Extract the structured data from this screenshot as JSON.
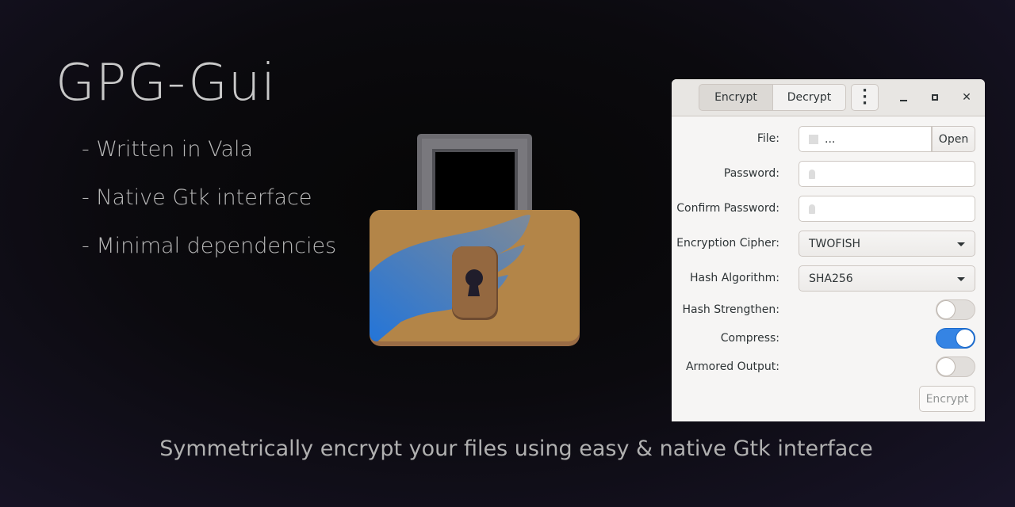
{
  "promo": {
    "title": "GPG-Gui",
    "bullets": [
      "- Written in Vala",
      "- Native Gtk interface",
      "- Minimal dependencies"
    ],
    "tagline": "Symmetrically encrypt your files using easy & native Gtk interface"
  },
  "window": {
    "tabs": [
      {
        "label": "Encrypt",
        "active": true
      },
      {
        "label": "Decrypt",
        "active": false
      }
    ],
    "menu_icon": "vertical-dots-icon",
    "controls": [
      "minimize-icon",
      "maximize-icon",
      "close-icon"
    ],
    "form": {
      "file_label": "File:",
      "file_value": "...",
      "open_label": "Open",
      "password_label": "Password:",
      "confirm_label": "Confirm Password:",
      "cipher_label": "Encryption Cipher:",
      "cipher_value": "TWOFISH",
      "hash_label": "Hash Algorithm:",
      "hash_value": "SHA256",
      "strengthen_label": "Hash Strengthen:",
      "strengthen_on": false,
      "compress_label": "Compress:",
      "compress_on": true,
      "armored_label": "Armored Output:",
      "armored_on": false,
      "submit_label": "Encrypt"
    },
    "accent": "#3584e4"
  }
}
